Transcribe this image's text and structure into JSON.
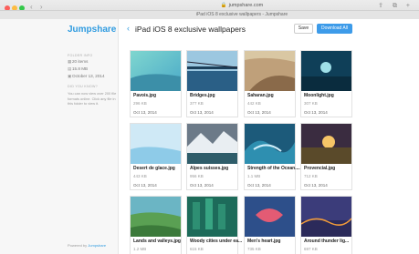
{
  "browser": {
    "address": "jumpshare.com",
    "tab_title": "iPad iOS 8 exclusive wallpapers - Jumpshare"
  },
  "sidebar": {
    "logo": "Jumpshare",
    "folder_info_heading": "FOLDER INFO",
    "items_count": "20 items",
    "folder_size": "15.8 MB",
    "folder_date": "October 13, 2014",
    "did_you_know_heading": "DID YOU KNOW?",
    "did_you_know_text": "You can now view over 200 file formats online. Click any file in this folder to view it.",
    "powered_by": "Powered by",
    "powered_link": "Jumpshare"
  },
  "header": {
    "title": "iPad iOS 8 exclusive wallpapers",
    "save_label": "Save",
    "download_label": "Download All"
  },
  "files": [
    {
      "name": "Pavois.jpg",
      "size": "296 KB",
      "date": "Oct 13, 2014"
    },
    {
      "name": "Bridges.jpg",
      "size": "377 KB",
      "date": "Oct 13, 2014"
    },
    {
      "name": "Saharan.jpg",
      "size": "442 KB",
      "date": "Oct 13, 2014"
    },
    {
      "name": "Moonlight.jpg",
      "size": "307 KB",
      "date": "Oct 13, 2014"
    },
    {
      "name": "Desert de glace.jpg",
      "size": "443 KB",
      "date": "Oct 13, 2014"
    },
    {
      "name": "Alpes suisses.jpg",
      "size": "956 KB",
      "date": "Oct 13, 2014"
    },
    {
      "name": "Strength of the Ocean....",
      "size": "1.1 MB",
      "date": "Oct 13, 2014"
    },
    {
      "name": "Provencial.jpg",
      "size": "712 KB",
      "date": "Oct 13, 2014"
    },
    {
      "name": "Lands and valleys.jpg",
      "size": "1.2 MB",
      "date": "Oct 13, 2014"
    },
    {
      "name": "Woody cities under ea...",
      "size": "615 KB",
      "date": "Oct 13, 2014"
    },
    {
      "name": "Men's heart.jpg",
      "size": "735 KB",
      "date": "Oct 13, 2014"
    },
    {
      "name": "Around thunder lig...",
      "size": "697 KB",
      "date": "Oct 13, 2014"
    }
  ],
  "colors": {
    "accent": "#2f9be0",
    "button_blue": "#3d9be9"
  }
}
